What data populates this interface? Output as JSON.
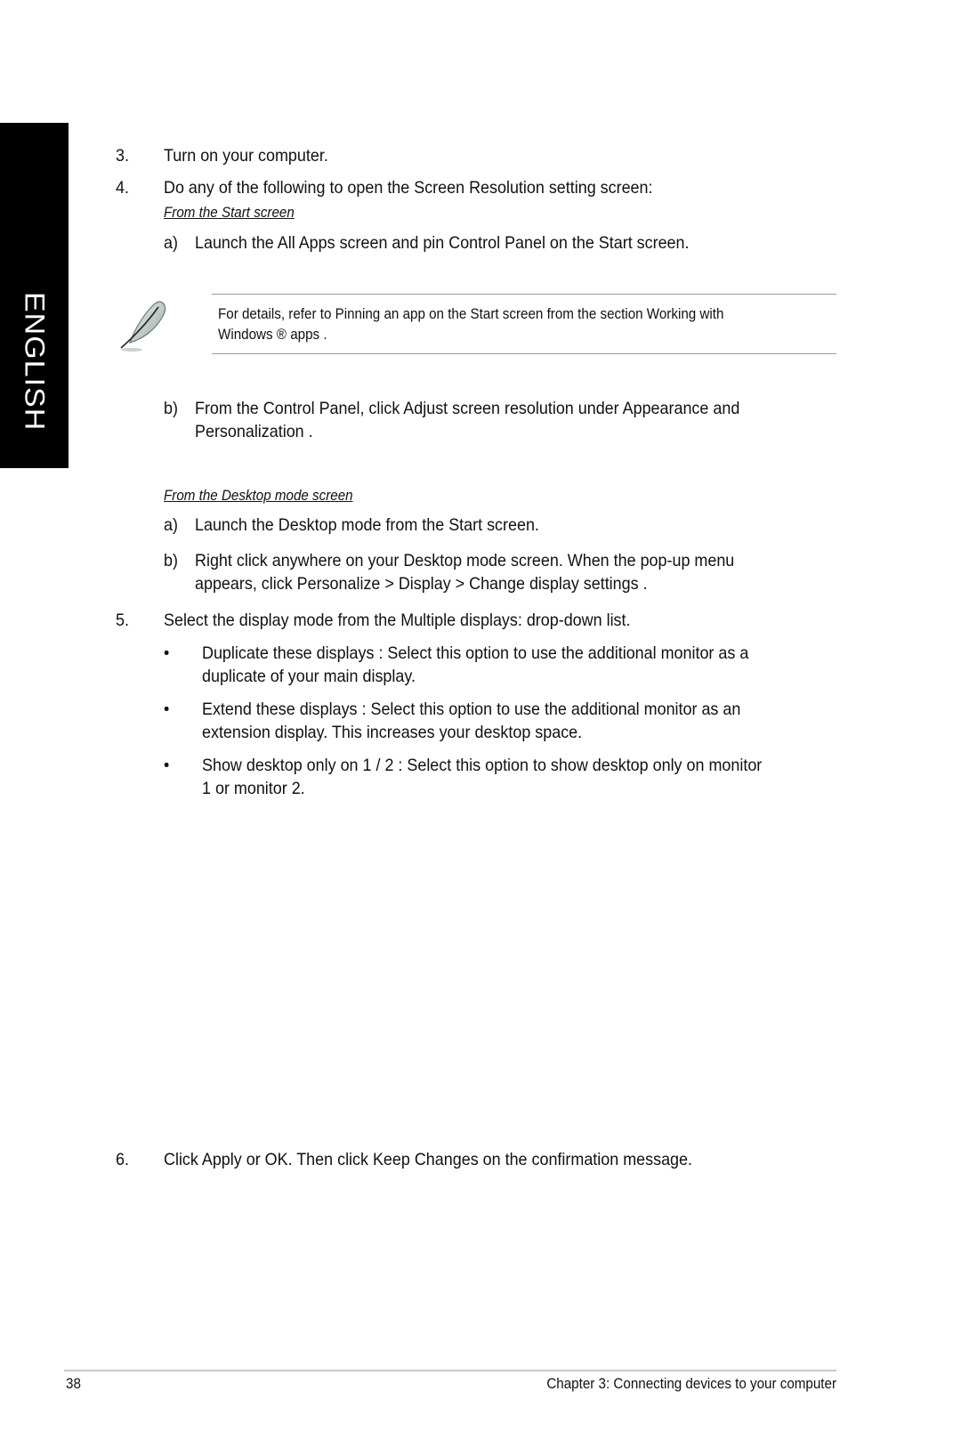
{
  "sidebar": {
    "language_tab": "ENGLISH"
  },
  "steps": {
    "s3": {
      "num": "3.",
      "text": "Turn on your computer."
    },
    "s4": {
      "num": "4.",
      "text": "Do any of the following to open the Screen Resolution   setting screen:",
      "start_screen": {
        "heading": "From the Start screen",
        "a": {
          "marker": "a)",
          "text": "Launch the All Apps screen and pin Control Panel on the Start screen."
        },
        "note": {
          "icon": "feather-note-icon",
          "line1": "For details, refer to Pinning an app on the Start screen     from the section Working with",
          "line2": "Windows ® apps ."
        },
        "b": {
          "marker": "b)",
          "line1": "From the Control Panel, click Adjust screen resolution     under Appearance and",
          "line2": "Personalization  ."
        }
      },
      "desktop_mode": {
        "heading": "From the Desktop mode screen",
        "a": {
          "marker": "a)",
          "text": "Launch the Desktop mode from the Start screen."
        },
        "b": {
          "marker": "b)",
          "line1": "Right click anywhere on your Desktop mode screen. When the pop-up menu",
          "line2": "appears, click Personalize  > Display  > Change display settings   ."
        }
      }
    },
    "s5": {
      "num": "5.",
      "text": "Select the display mode from the Multiple displays:   drop-down list.",
      "bullets": [
        {
          "line1": "Duplicate these displays   : Select this option to use the additional monitor as a",
          "line2": "duplicate of your main display."
        },
        {
          "line1": "Extend these displays   : Select this option to use the additional monitor as an",
          "line2": "extension display. This increases your desktop space."
        },
        {
          "line1": "Show desktop only on 1 / 2   : Select this option to show desktop only on monitor",
          "line2": "1 or monitor 2."
        }
      ],
      "bullet_glyph": "•"
    },
    "s6": {
      "num": "6.",
      "text": "Click Apply  or OK. Then click Keep Changes  on the confirmation message."
    }
  },
  "footer": {
    "page_number": "38",
    "chapter": "Chapter 3: Connecting devices to your computer"
  }
}
